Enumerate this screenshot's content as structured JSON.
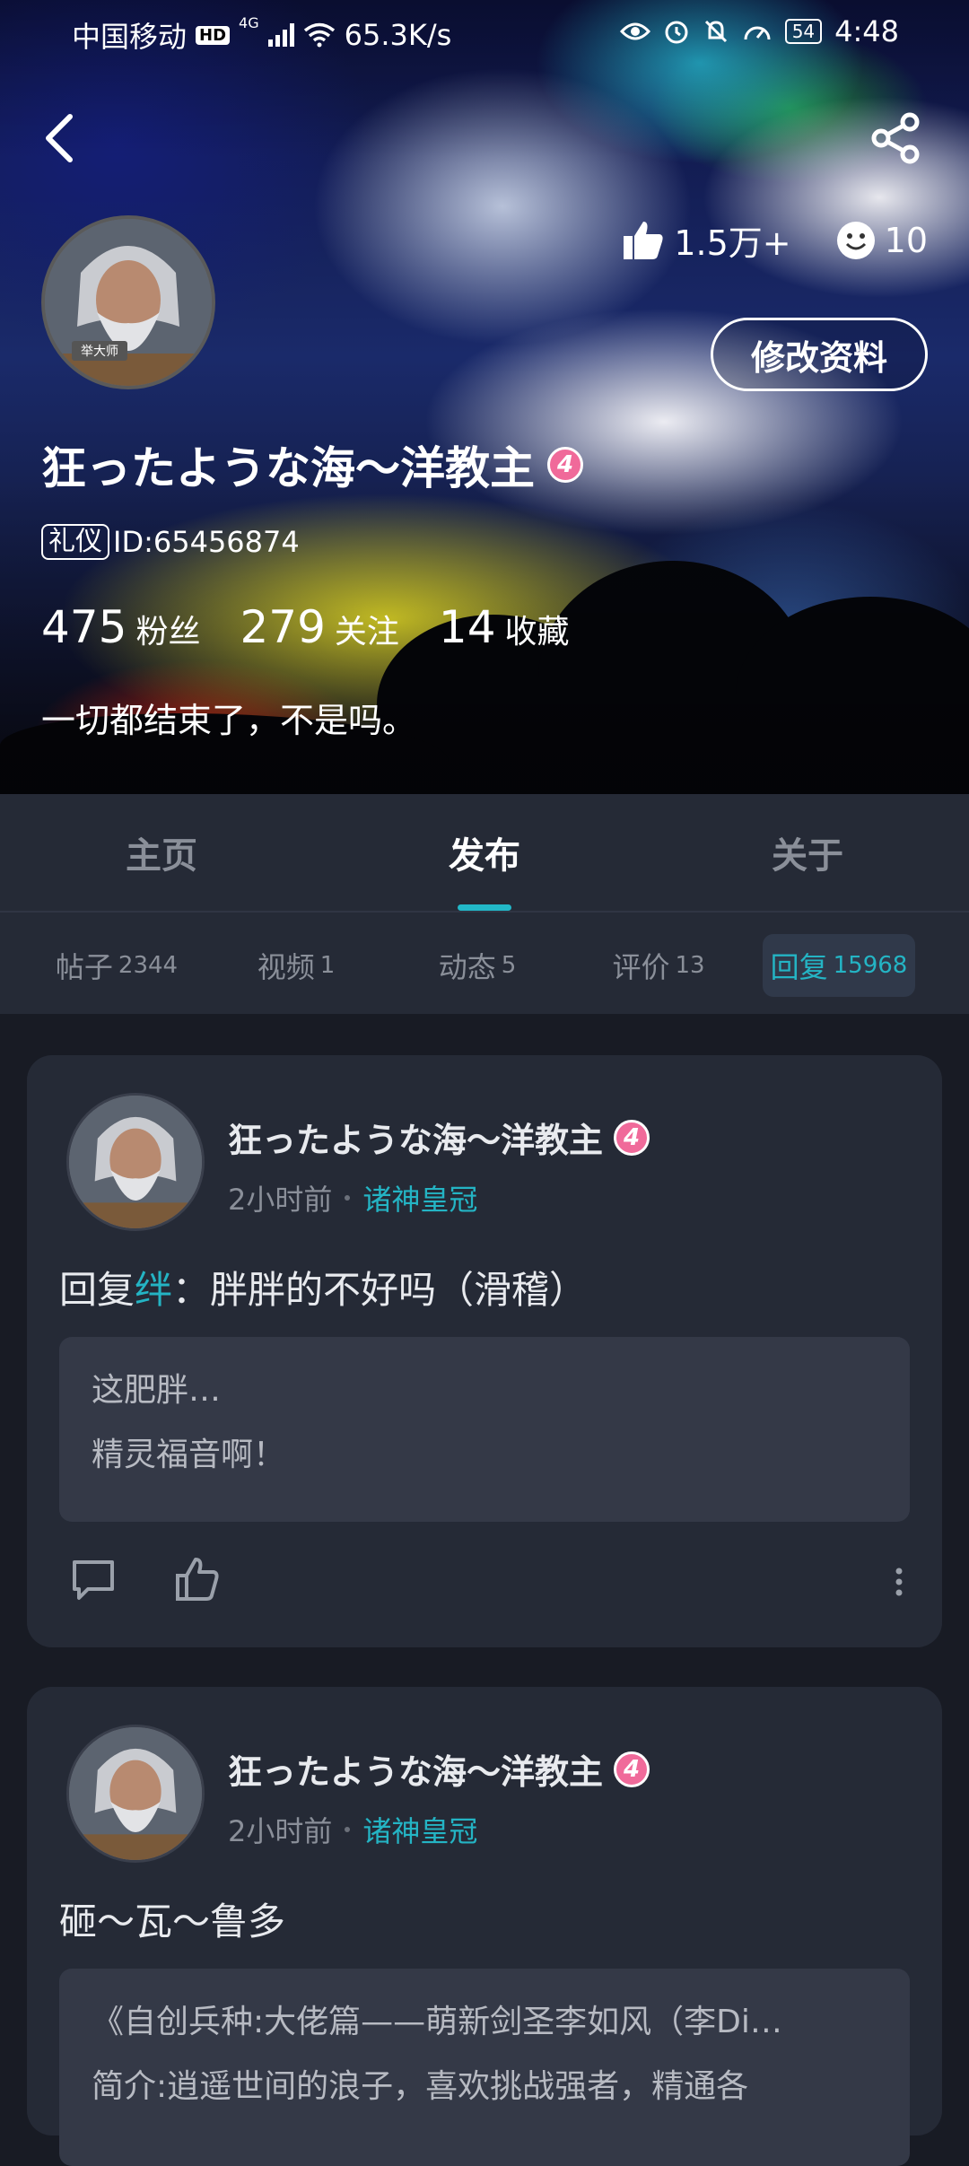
{
  "status_bar": {
    "carrier": "中国移动",
    "hd": "HD",
    "network": "4G",
    "speed": "65.3K/s",
    "battery": "54",
    "time": "4:48"
  },
  "profile": {
    "likes": "1.5万+",
    "emoji_count": "10",
    "edit_label": "修改资料",
    "name": "狂ったような海～洋教主",
    "level": "4",
    "tag": "礼仪",
    "id_text": "ID:65456874",
    "fans_num": "475",
    "fans_label": "粉丝",
    "follow_num": "279",
    "follow_label": "关注",
    "fav_num": "14",
    "fav_label": "收藏",
    "bio": "一切都结束了，不是吗。",
    "avatar_caption": "举大师"
  },
  "tabs": [
    {
      "label": "主页"
    },
    {
      "label": "发布"
    },
    {
      "label": "关于"
    }
  ],
  "subtabs": [
    {
      "label": "帖子",
      "count": "2344"
    },
    {
      "label": "视频",
      "count": "1"
    },
    {
      "label": "动态",
      "count": "5"
    },
    {
      "label": "评价",
      "count": "13"
    },
    {
      "label": "回复",
      "count": "15968"
    }
  ],
  "posts": [
    {
      "author": "狂ったような海～洋教主",
      "level": "4",
      "time": "2小时前",
      "forum": "诸神皇冠",
      "title_prefix": "回复",
      "title_highlight": "绊",
      "title_suffix": "：胖胖的不好吗（滑稽）",
      "quote_lines": [
        "这肥胖…",
        "精灵福音啊！"
      ]
    },
    {
      "author": "狂ったような海～洋教主",
      "level": "4",
      "time": "2小时前",
      "forum": "诸神皇冠",
      "title": "砸～瓦～鲁多",
      "quote_lines": [
        "《自创兵种:大佬篇——萌新剑圣李如风（李Di…",
        "简介:逍遥世间的浪子，喜欢挑战强者，精通各"
      ]
    }
  ],
  "colors": {
    "accent": "#24b4c4",
    "background": "#181b24",
    "card": "#252a36",
    "level_badge": "#f06a9a"
  }
}
